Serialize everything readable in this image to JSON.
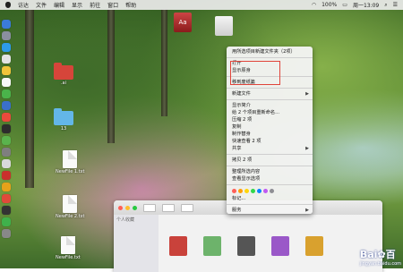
{
  "menubar": {
    "app_items": [
      "访达",
      "文件",
      "编辑",
      "显示",
      "前往",
      "窗口",
      "帮助"
    ],
    "status": {
      "time": "周一13:09",
      "battery": "100%"
    }
  },
  "desktop": {
    "icons": [
      {
        "label": ""
      },
      {
        "label": ""
      },
      {
        "label": ".ai"
      },
      {
        "label": "13"
      },
      {
        "label": "NewFile 1.txt"
      },
      {
        "label": "NewFile 2.txt"
      },
      {
        "label": "NewFile.txt"
      }
    ]
  },
  "context_menu": {
    "items": [
      {
        "label": "用所选项目新建文件夹（2项）",
        "submenu": false
      },
      {
        "label": "打开",
        "submenu": false
      },
      {
        "label": "显示原身",
        "submenu": false
      },
      {
        "label": "移到废纸篓",
        "submenu": false
      },
      {
        "label": "新建文件",
        "submenu": true
      },
      {
        "label": "显示简介",
        "submenu": false
      },
      {
        "label": "给 2 个项目重新命名...",
        "submenu": false
      },
      {
        "label": "压缩 2 项",
        "submenu": false
      },
      {
        "label": "复制",
        "submenu": false
      },
      {
        "label": "制作替身",
        "submenu": false
      },
      {
        "label": "快速查看 2 项",
        "submenu": false
      },
      {
        "label": "共享",
        "submenu": true
      },
      {
        "label": "拷贝 2 项",
        "submenu": false
      },
      {
        "label": "整理所选内容",
        "submenu": false
      },
      {
        "label": "查看显示选项",
        "submenu": false
      },
      {
        "label": "标记...",
        "submenu": false
      },
      {
        "label": "服务",
        "submenu": true
      }
    ],
    "tag_colors": [
      "#ff5f57",
      "#ff9f0a",
      "#ffd60a",
      "#32d74b",
      "#0a84ff",
      "#bf5af2",
      "#8e8e93"
    ],
    "highlight_color": "#e0443a"
  },
  "finder": {
    "sidebar_label": "个人收藏"
  },
  "watermark": {
    "brand": "Bai",
    "brand2": "百",
    "sub": "jingyan.baidu.com"
  }
}
